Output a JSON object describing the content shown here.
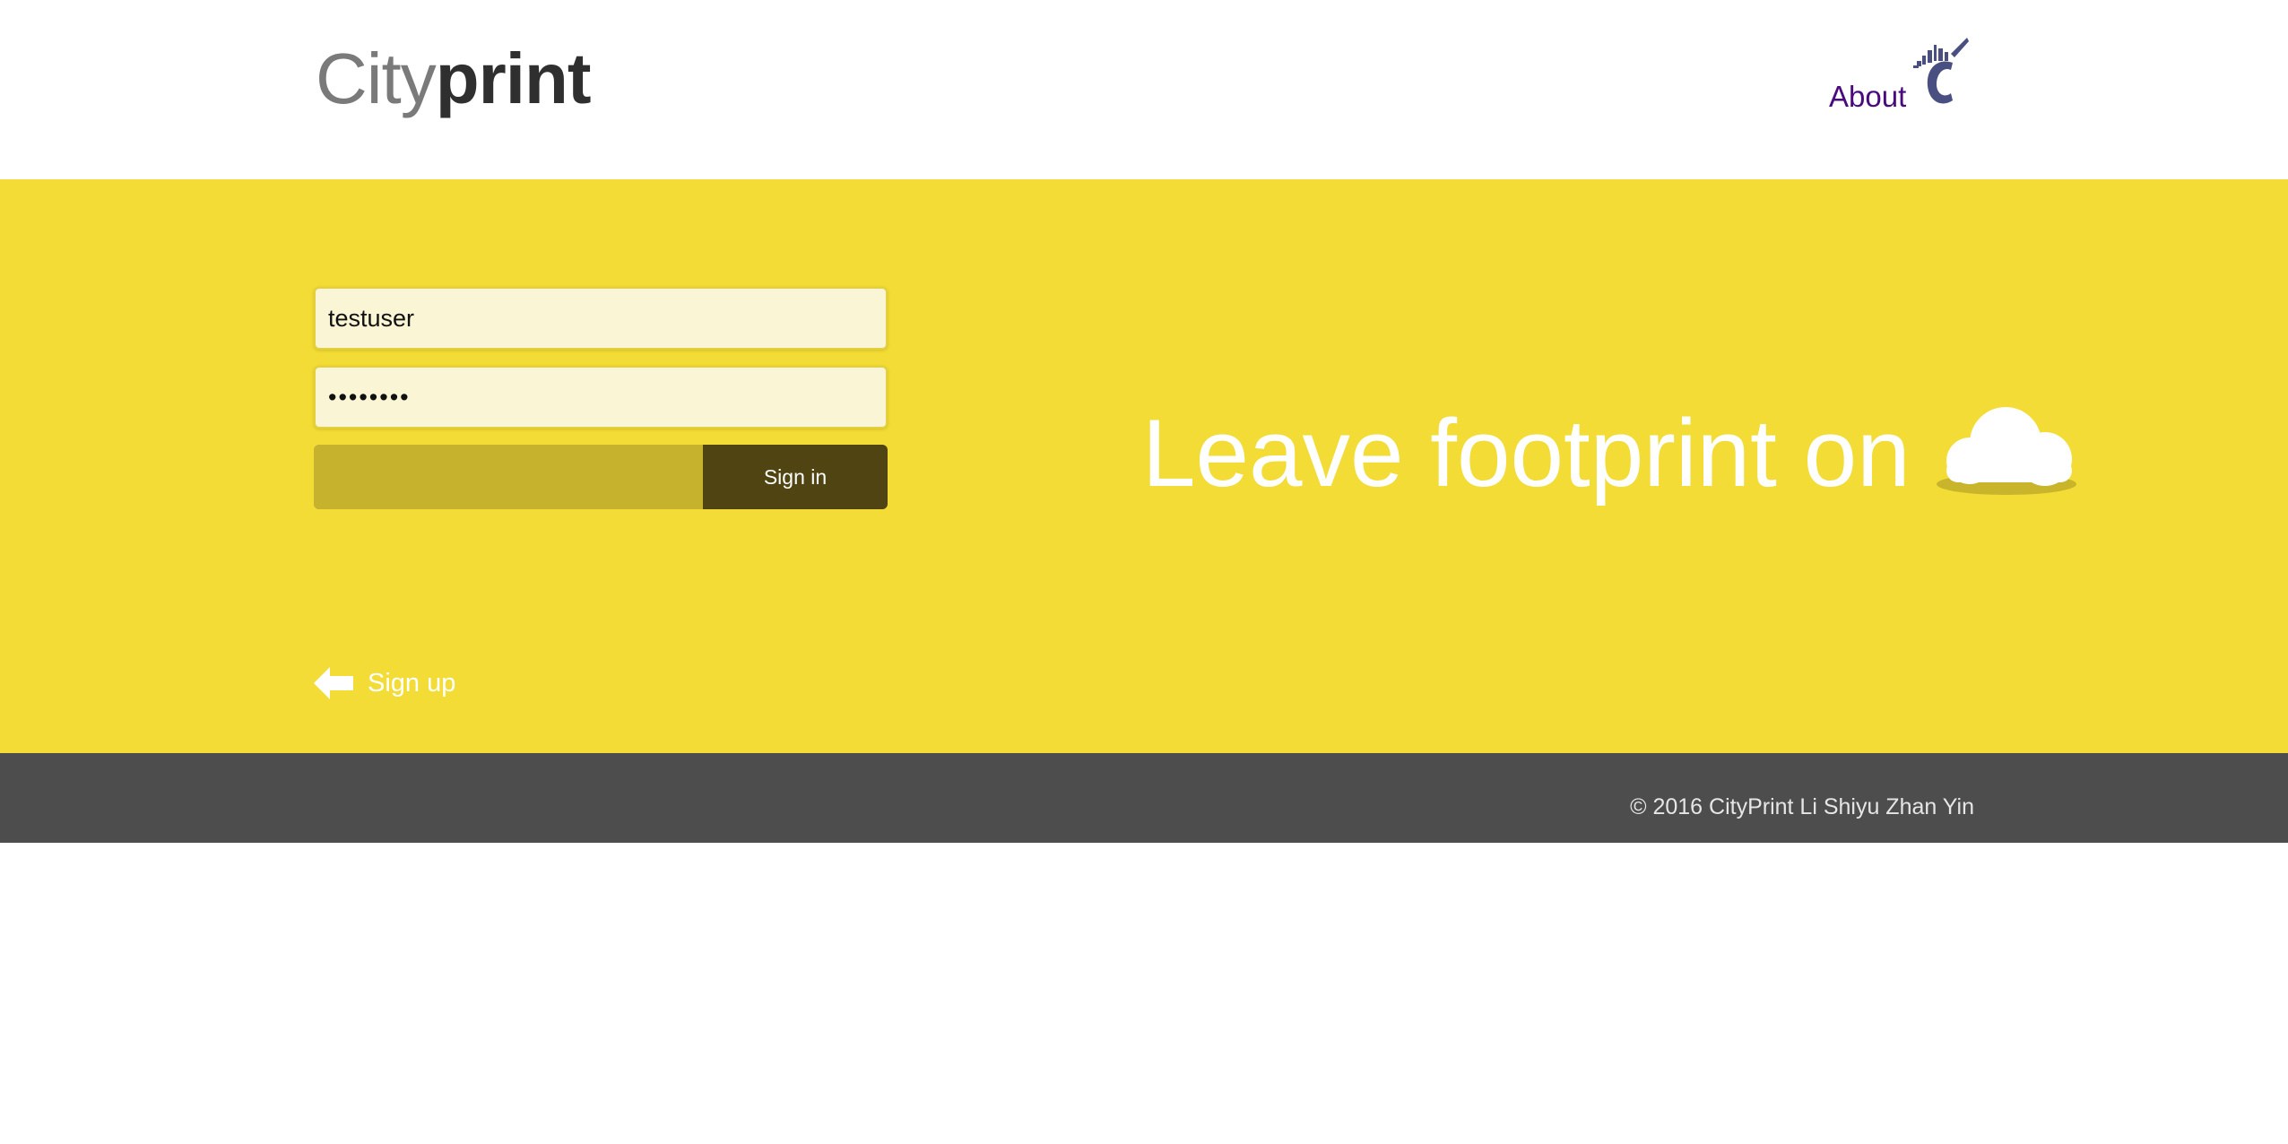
{
  "header": {
    "logo": {
      "part1": "City",
      "part2": "print"
    },
    "nav": {
      "about_label": "About"
    },
    "brand_mark_icon": "cityprint-c-skyline-icon"
  },
  "login": {
    "username": {
      "value": "testuser",
      "placeholder": ""
    },
    "password": {
      "value": "testuser",
      "placeholder": ""
    },
    "sign_in_label": "Sign in",
    "sign_up_label": "Sign up",
    "sign_up_icon": "arrow-left-icon"
  },
  "hero": {
    "tagline": "Leave footprint on",
    "tagline_icon": "cloud-icon"
  },
  "footer": {
    "copyright": "© 2016 CityPrint Li Shiyu Zhan Yin"
  },
  "colors": {
    "hero_bg": "#f2dc35",
    "footer_bg": "#4d4d4d",
    "sign_in_bg": "#4f4412",
    "bar_bg": "#c6b22d",
    "about_link": "#4b0a7c"
  }
}
